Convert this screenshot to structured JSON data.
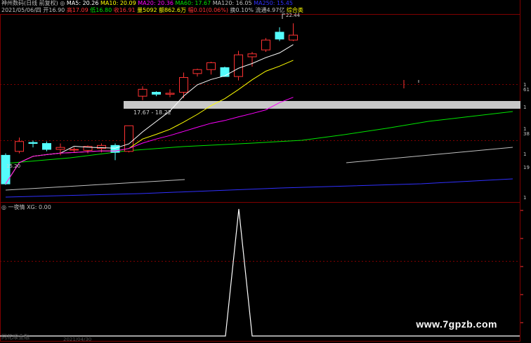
{
  "header": {
    "stock_name": "神州数码(日线 前复权)",
    "ma5": "MA5: 20.26",
    "ma10": "MA10: 20.09",
    "ma20": "MA20: 20.36",
    "ma60": "MA60: 17.67",
    "ma120": "MA120: 16.05",
    "ma250": "MA250: 15.45"
  },
  "quote_bar": {
    "date": "2021/05/06/四",
    "open": "开16.90",
    "high": "高17.09",
    "low": "低16.80",
    "close": "收16.91",
    "volume": "量5092",
    "amount": "额862.6万",
    "change": "幅0.01(0.06%)",
    "turnover": "换0.10%",
    "float": "流通4.97亿",
    "industry": "综合类"
  },
  "annotations": {
    "high_price": "22.44",
    "low_price": "15.20",
    "gap_range": "17.67 - 18.22"
  },
  "right_axis_ticks": [
    "1",
    "61",
    "1",
    "1",
    "38",
    "1",
    "19",
    "1"
  ],
  "indicator": {
    "title": "一夜情",
    "value": "XG: 0.00"
  },
  "bottom": {
    "left_text": "同花顺金融",
    "date_text": "2021/04/30"
  },
  "watermark": "www.7gpzb.com",
  "colors": {
    "up": "#ff3232",
    "down": "#54fcfc",
    "ma5": "#ffffff",
    "ma10": "#ffff00",
    "ma20": "#ff00ff",
    "ma60": "#00e600",
    "ma120": "#c0c0c0",
    "ma250": "#3030ff",
    "grid": "#800000",
    "gap_band": "#c8c8c8"
  },
  "chart_data": {
    "type": "candlestick",
    "candles": [
      {
        "o": 16.7,
        "h": 16.8,
        "l": 15.2,
        "c": 15.25
      },
      {
        "o": 16.9,
        "h": 17.6,
        "l": 16.8,
        "c": 17.4
      },
      {
        "o": 17.35,
        "h": 17.45,
        "l": 17.1,
        "c": 17.3
      },
      {
        "o": 17.3,
        "h": 17.4,
        "l": 16.9,
        "c": 17.0
      },
      {
        "o": 17.0,
        "h": 17.3,
        "l": 16.7,
        "c": 17.1
      },
      {
        "o": 17.0,
        "h": 17.1,
        "l": 16.85,
        "c": 17.0
      },
      {
        "o": 16.95,
        "h": 17.2,
        "l": 16.8,
        "c": 17.15
      },
      {
        "o": 17.05,
        "h": 17.3,
        "l": 16.85,
        "c": 17.2
      },
      {
        "o": 17.2,
        "h": 17.3,
        "l": 16.45,
        "c": 16.85
      },
      {
        "o": 16.9,
        "h": 18.2,
        "l": 16.85,
        "c": 18.2
      },
      {
        "o": 19.7,
        "h": 20.2,
        "l": 19.5,
        "c": 20.05
      },
      {
        "o": 19.9,
        "h": 19.95,
        "l": 19.7,
        "c": 19.8
      },
      {
        "o": 19.8,
        "h": 20.05,
        "l": 19.65,
        "c": 19.85
      },
      {
        "o": 19.9,
        "h": 20.9,
        "l": 19.6,
        "c": 20.65
      },
      {
        "o": 20.85,
        "h": 21.1,
        "l": 20.7,
        "c": 21.05
      },
      {
        "o": 21.05,
        "h": 21.45,
        "l": 20.8,
        "c": 21.4
      },
      {
        "o": 21.15,
        "h": 21.2,
        "l": 20.7,
        "c": 20.7
      },
      {
        "o": 20.7,
        "h": 22.0,
        "l": 20.5,
        "c": 21.8
      },
      {
        "o": 21.7,
        "h": 21.95,
        "l": 21.2,
        "c": 21.85
      },
      {
        "o": 22.05,
        "h": 22.65,
        "l": 21.95,
        "c": 22.55
      },
      {
        "o": 22.95,
        "h": 23.2,
        "l": 22.5,
        "c": 22.6
      },
      {
        "o": 22.55,
        "h": 23.4,
        "l": 22.5,
        "c": 22.8
      }
    ],
    "signal": {
      "peak_value": 1,
      "peak_index": 19
    },
    "y_range": [
      14.4,
      23.8
    ],
    "gap": {
      "low": 17.67,
      "high": 18.22
    }
  }
}
